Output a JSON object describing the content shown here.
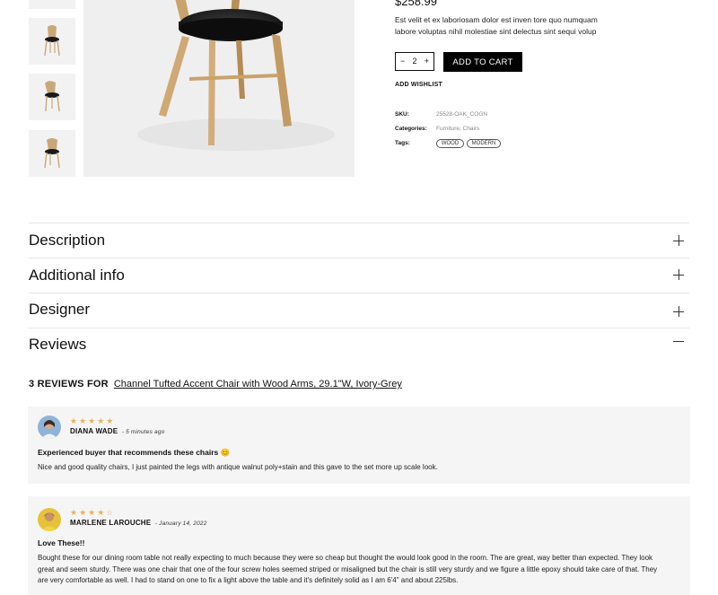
{
  "product": {
    "price": "$258.99",
    "description": "Est velit et ex laboriosam dolor est inven tore quo numquam labore voluptas nihil molestiae sint delectus sint sequi volup",
    "quantity": "2",
    "qty_minus": "−",
    "qty_plus": "+",
    "add_to_cart": "ADD TO CART",
    "add_wishlist": "ADD WISHLIST",
    "sku_label": "SKU:",
    "sku_value": "25528-OAK_COGN",
    "categories_label": "Categories:",
    "categories_value": "Furniture, Chairs",
    "tags_label": "Tags:",
    "tags": [
      "WOOD",
      "MODERN"
    ]
  },
  "accordion": [
    {
      "title": "Description",
      "state": "collapsed"
    },
    {
      "title": "Additional info",
      "state": "collapsed"
    },
    {
      "title": "Designer",
      "state": "collapsed"
    },
    {
      "title": "Reviews",
      "state": "expanded"
    }
  ],
  "reviews_section": {
    "count_label": "3 REVIEWS FOR",
    "product_link": "Channel Tufted Accent Chair with Wood Arms, 29.1\"W, Ivory-Grey"
  },
  "reviews": [
    {
      "stars": "★★★★★",
      "rating": 5,
      "author": "DIANA WADE",
      "when": "- 5 minutes ago",
      "title": "Experienced buyer that recommends these chairs 😊",
      "body": "Nice and good quality chairs, I just painted the legs with antique walnut poly+stain and this gave to the set more up scale look."
    },
    {
      "stars": "★★★★☆",
      "rating": 4,
      "author": "MARLENE LAROUCHE",
      "when": "- January 14, 2022",
      "title": "Love These!!",
      "body": "Bought these for our dining room table not really expecting to much because they were so cheap but thought the would look good in the room. The are great, way better than expected. They look great and seem sturdy. There was one chair that one of the four screw holes seemed striped or misaligned but the chair is still very sturdy and we figure a little epoxy should take care of that. They are very comfortable as well. I had to stand on one to fix a light above the table and it's definitely solid as I am 6'4\" and about 225lbs."
    }
  ],
  "colors": {
    "accent_star": "#e7b25e",
    "button_bg": "#000000",
    "card_bg": "#f5f5f5"
  }
}
